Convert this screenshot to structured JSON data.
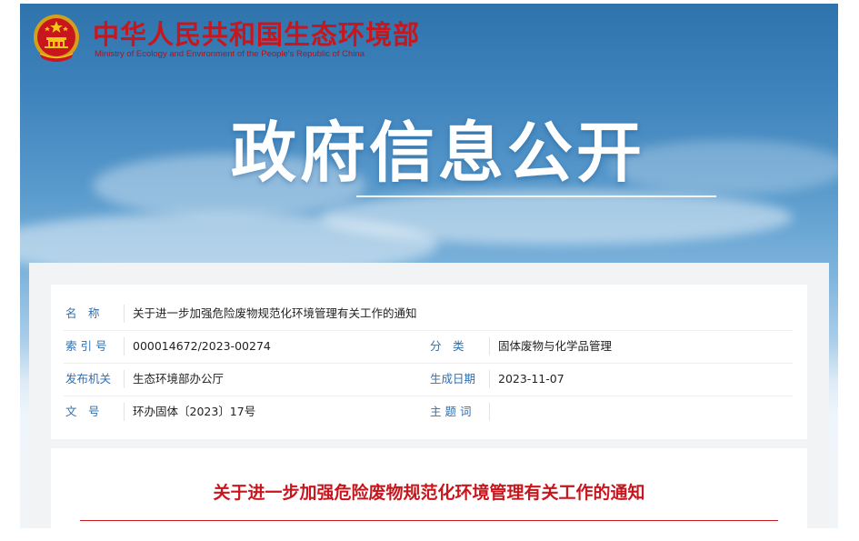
{
  "header": {
    "ministry_cn": "中华人民共和国生态环境部",
    "ministry_en": "Ministry of Ecology and Environment of the People's Republic of China",
    "banner_title": "政府信息公开"
  },
  "metadata": {
    "name_label": "名　称",
    "name_value": "关于进一步加强危险废物规范化环境管理有关工作的通知",
    "index_label": "索 引 号",
    "index_value": "000014672/2023-00274",
    "category_label": "分　类",
    "category_value": "固体废物与化学品管理",
    "issuer_label": "发布机关",
    "issuer_value": "生态环境部办公厅",
    "date_label": "生成日期",
    "date_value": "2023-11-07",
    "doc_no_label": "文　号",
    "doc_no_value": "环办固体〔2023〕17号",
    "subject_label": "主 题 词",
    "subject_value": ""
  },
  "document": {
    "title": "关于进一步加强危险废物规范化环境管理有关工作的通知"
  },
  "colors": {
    "brand_red": "#c8161d",
    "label_blue": "#2f6fb1"
  }
}
